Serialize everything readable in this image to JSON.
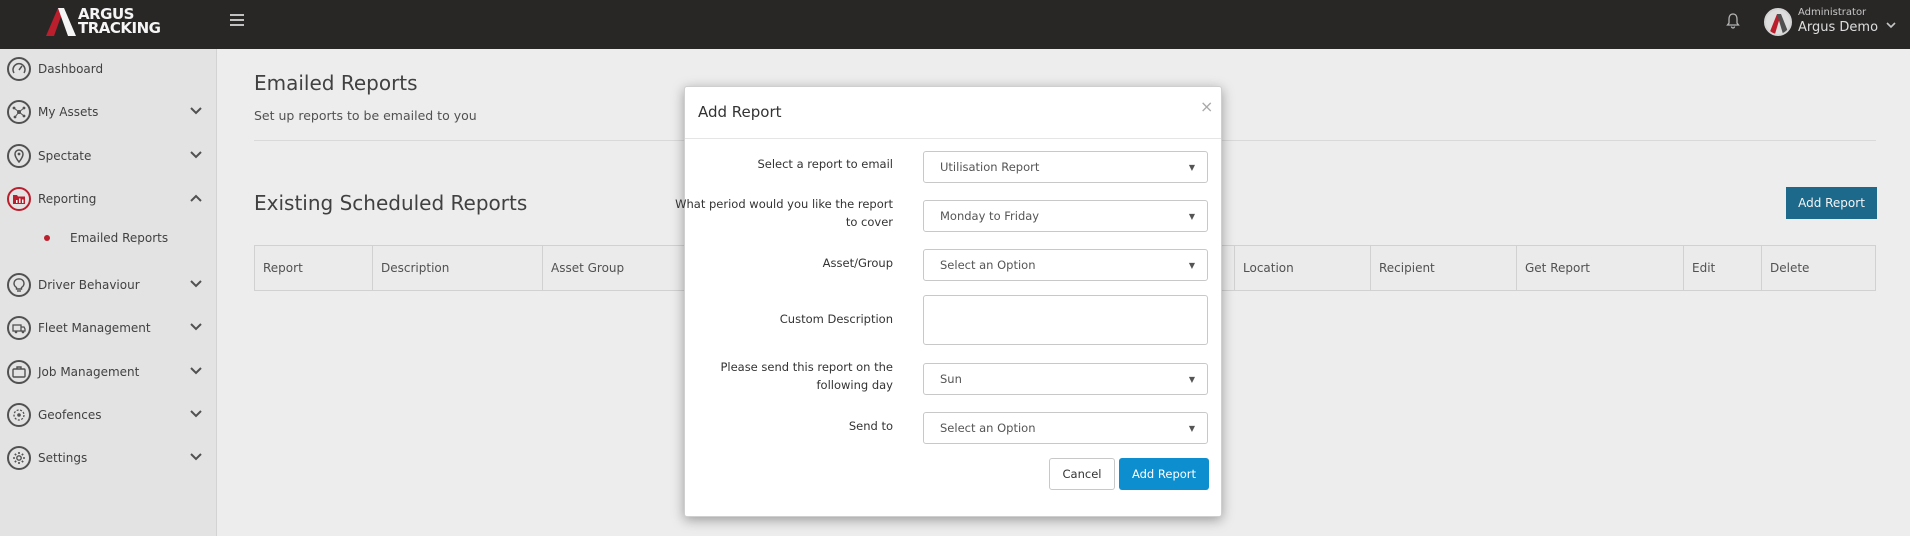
{
  "brand": {
    "line1": "ARGUS",
    "line2": "TRACKING",
    "accent": "#c3202f"
  },
  "header": {
    "user_role": "Administrator",
    "user_name": "Argus Demo"
  },
  "sidebar": {
    "items": [
      {
        "label": "Dashboard",
        "icon": "gauge-icon"
      },
      {
        "label": "My Assets",
        "icon": "network-icon"
      },
      {
        "label": "Spectate",
        "icon": "map-pin-icon"
      },
      {
        "label": "Reporting",
        "icon": "folder-chart-icon"
      },
      {
        "label": "Driver Behaviour",
        "icon": "driver-lightbulb-icon"
      },
      {
        "label": "Fleet Management",
        "icon": "truck-icon"
      },
      {
        "label": "Job Management",
        "icon": "briefcase-icon"
      },
      {
        "label": "Geofences",
        "icon": "geofence-icon"
      },
      {
        "label": "Settings",
        "icon": "gear-icon"
      }
    ],
    "sub_item": {
      "label": "Emailed Reports"
    }
  },
  "main": {
    "title": "Emailed Reports",
    "subtitle": "Set up reports to be emailed to you",
    "section_title": "Existing Scheduled Reports",
    "add_button": "Add Report",
    "columns": [
      "Report",
      "Description",
      "Asset Group",
      "Location",
      "Recipient",
      "Get Report",
      "Edit",
      "Delete"
    ]
  },
  "modal": {
    "title": "Add Report",
    "close": "×",
    "fields": {
      "report_label": "Select a report to email",
      "report_value": "Utilisation Report",
      "period_label": "What period would you like the report to cover",
      "period_value": "Monday to Friday",
      "asset_label": "Asset/Group",
      "asset_value": "Select an Option",
      "desc_label": "Custom Description",
      "day_label": "Please send this report on the following day",
      "day_value": "Sun",
      "sendto_label": "Send to",
      "sendto_value": "Select an Option"
    },
    "cancel": "Cancel",
    "submit": "Add Report"
  }
}
